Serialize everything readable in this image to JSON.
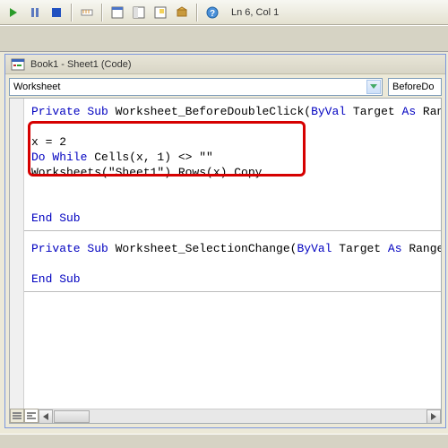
{
  "toolbar": {
    "cursor_pos": "Ln 6, Col 1"
  },
  "window": {
    "title": "Book1 - Sheet1 (Code)"
  },
  "dropdowns": {
    "object": "Worksheet",
    "procedure": "BeforeDo"
  },
  "code": {
    "l1_a": "Private Sub",
    "l1_b": " Worksheet_BeforeDoubleClick(",
    "l1_c": "ByVal",
    "l1_d": " Target ",
    "l1_e": "As",
    "l1_f": " Range,",
    "l2": "",
    "l3_a": "x = 2",
    "l4_a": "Do While",
    "l4_b": " Cells(x, 1) <> \"\"",
    "l5_a": "Worksheets(\"Sheet1\").Rows(x).Copy",
    "l6": "",
    "l7": "",
    "l8_a": "End Sub",
    "l9": "",
    "l10_a": "Private Sub",
    "l10_b": " Worksheet_SelectionChange(",
    "l10_c": "ByVal",
    "l10_d": " Target ",
    "l10_e": "As",
    "l10_f": " Range)",
    "l11": "",
    "l12_a": "End Sub"
  }
}
